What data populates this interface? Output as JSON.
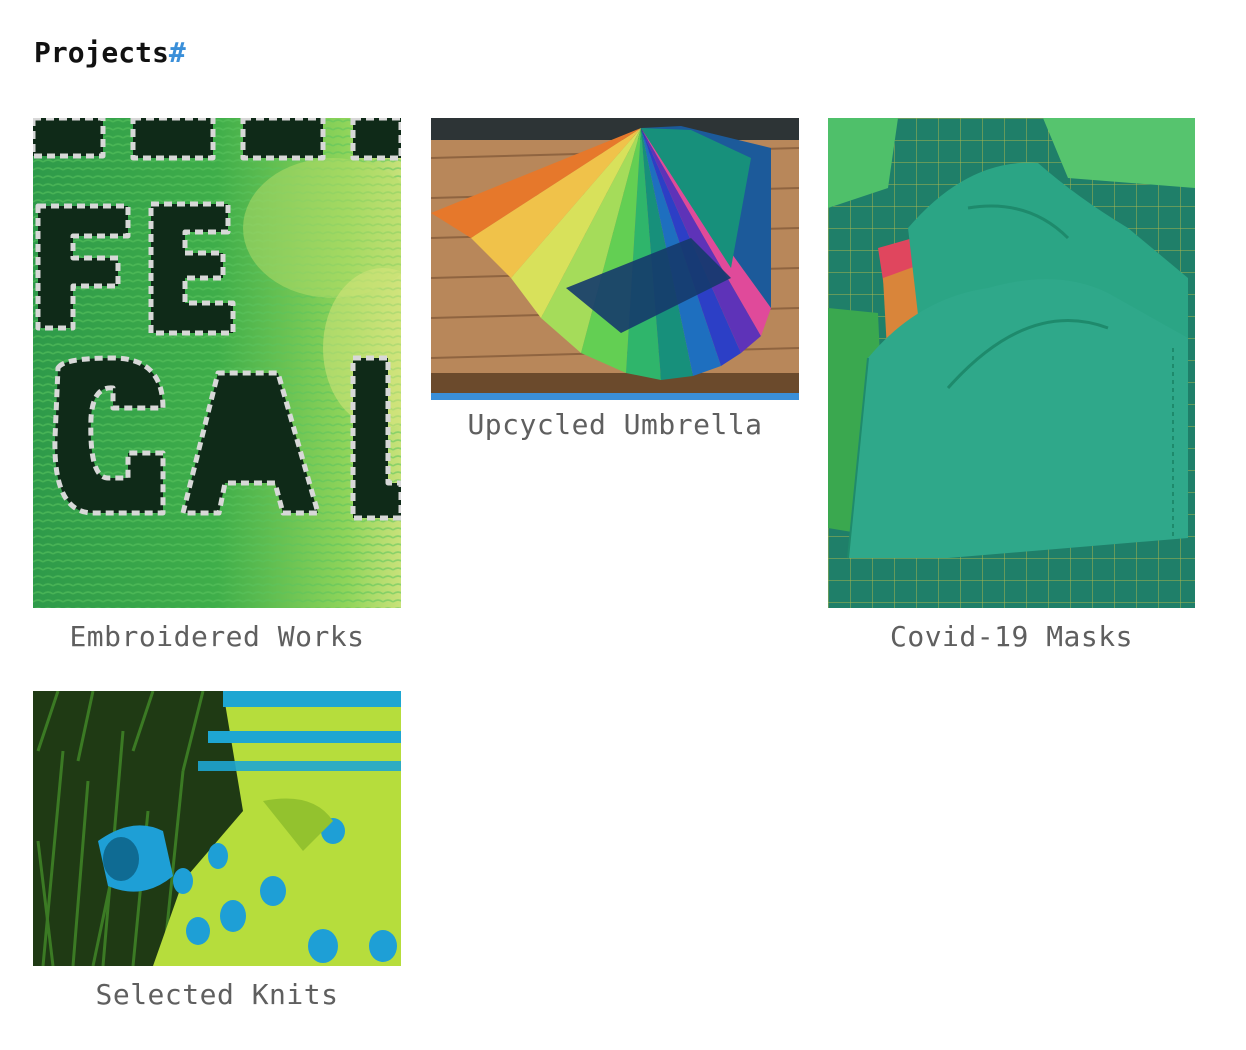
{
  "page": {
    "heading": "Projects",
    "heading_anchor": "#"
  },
  "projects": [
    {
      "title": "Embroidered Works"
    },
    {
      "title": "Upcycled Umbrella"
    },
    {
      "title": "Covid-19 Masks"
    },
    {
      "title": "Selected Knits"
    }
  ],
  "colors": {
    "accent": "#3a8fd9",
    "caption": "#5f5f5f",
    "heading": "#111111"
  }
}
